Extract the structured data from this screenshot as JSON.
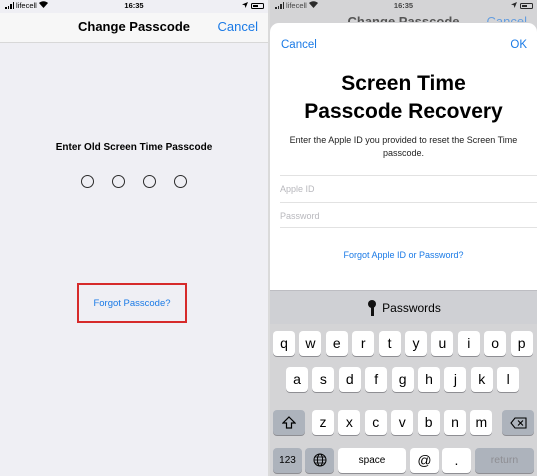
{
  "left": {
    "status": {
      "carrier": "lifecell",
      "time": "16:35"
    },
    "nav": {
      "title": "Change Passcode",
      "cancel": "Cancel"
    },
    "prompt": "Enter Old Screen Time Passcode",
    "forgot_link": "Forgot Passcode?",
    "highlight_color": "#d62a2a"
  },
  "right": {
    "status": {
      "carrier": "lifecell",
      "time": "16:35"
    },
    "background_nav": {
      "title": "Change Passcode",
      "cancel": "Cancel"
    },
    "sheet": {
      "cancel": "Cancel",
      "ok": "OK",
      "title_line1": "Screen Time",
      "title_line2": "Passcode Recovery",
      "description": "Enter the Apple ID you provided to reset the Screen Time passcode.",
      "apple_id_placeholder": "Apple ID",
      "password_placeholder": "Password",
      "forgot_link": "Forgot Apple ID or Password?"
    },
    "passwords_bar": {
      "label": "Passwords",
      "icon": "key-icon"
    },
    "keyboard": {
      "row1": [
        "q",
        "w",
        "e",
        "r",
        "t",
        "y",
        "u",
        "i",
        "o",
        "p"
      ],
      "row2": [
        "a",
        "s",
        "d",
        "f",
        "g",
        "h",
        "j",
        "k",
        "l"
      ],
      "row3": [
        "z",
        "x",
        "c",
        "v",
        "b",
        "n",
        "m"
      ],
      "shift_icon": "shift-icon",
      "delete_icon": "delete-icon",
      "globe_icon": "globe-icon",
      "numbers_key": "123",
      "space_key": "space",
      "at_key": "@",
      "dot_key": ".",
      "return_key": "return"
    }
  },
  "accent_color": "#1a7ae6"
}
